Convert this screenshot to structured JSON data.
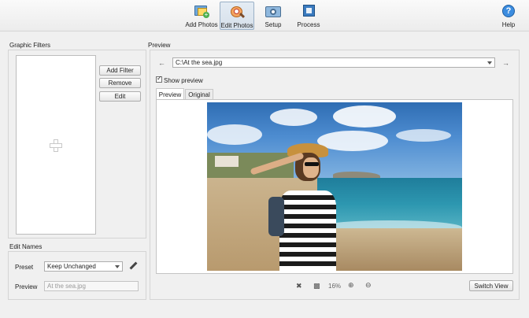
{
  "toolbar": {
    "add_photos": "Add Photos",
    "edit_photos": "Edit Photos",
    "setup": "Setup",
    "process": "Process",
    "help": "Help"
  },
  "graphic_filters": {
    "title": "Graphic Filters",
    "add_filter": "Add Filter",
    "remove": "Remove",
    "edit": "Edit"
  },
  "edit_names": {
    "title": "Edit Names",
    "preset_label": "Preset",
    "preset_value": "Keep Unchanged",
    "preview_label": "Preview",
    "preview_placeholder": "At the sea.jpg"
  },
  "preview": {
    "title": "Preview",
    "file_path": "C:\\At the sea.jpg",
    "show_preview_label": "Show preview",
    "show_preview_checked": true,
    "tabs": [
      "Preview",
      "Original"
    ],
    "zoom": "16%",
    "switch_view": "Switch View"
  }
}
